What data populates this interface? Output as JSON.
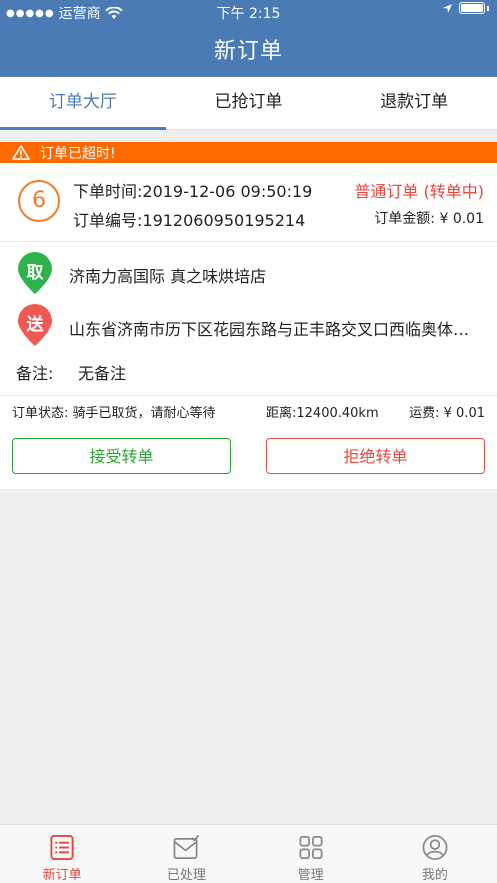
{
  "status_bar": {
    "carrier": "运营商",
    "time": "下午 2:15"
  },
  "nav": {
    "title": "新订单"
  },
  "tabs": [
    {
      "label": "订单大厅",
      "active": true
    },
    {
      "label": "已抢订单",
      "active": false
    },
    {
      "label": "退款订单",
      "active": false
    }
  ],
  "alert": {
    "text": "订单已超时!"
  },
  "order": {
    "number": "6",
    "time_text": "下单时间:2019-12-06 09:50:19",
    "type_text": "普通订单 (转单中)",
    "order_no_text": "订单编号:1912060950195214",
    "amount_text": "订单金额: ¥ 0.01",
    "pickup_badge": "取",
    "pickup_address": "济南力高国际  真之味烘培店",
    "deliver_badge": "送",
    "deliver_address": "山东省济南市历下区花园东路与正丰路交叉口西临奥体中路",
    "remark_label": "备注:",
    "remark_value": "无备注",
    "status_text": "订单状态:  骑手已取货，请耐心等待",
    "distance_text": "距离:12400.40km",
    "fee_text": "运费: ¥ 0.01",
    "accept_label": "接受转单",
    "reject_label": "拒绝转单"
  },
  "tabbar": [
    {
      "label": "新订单",
      "icon": "list-icon",
      "active": true
    },
    {
      "label": "已处理",
      "icon": "mail-check-icon",
      "active": false
    },
    {
      "label": "管理",
      "icon": "grid-icon",
      "active": false
    },
    {
      "label": "我的",
      "icon": "user-icon",
      "active": false
    }
  ],
  "colors": {
    "primary": "#4a7bb5",
    "alert": "#ff6a00",
    "accent_orange": "#f07d2a",
    "red": "#e8453c",
    "green": "#2aa637"
  }
}
